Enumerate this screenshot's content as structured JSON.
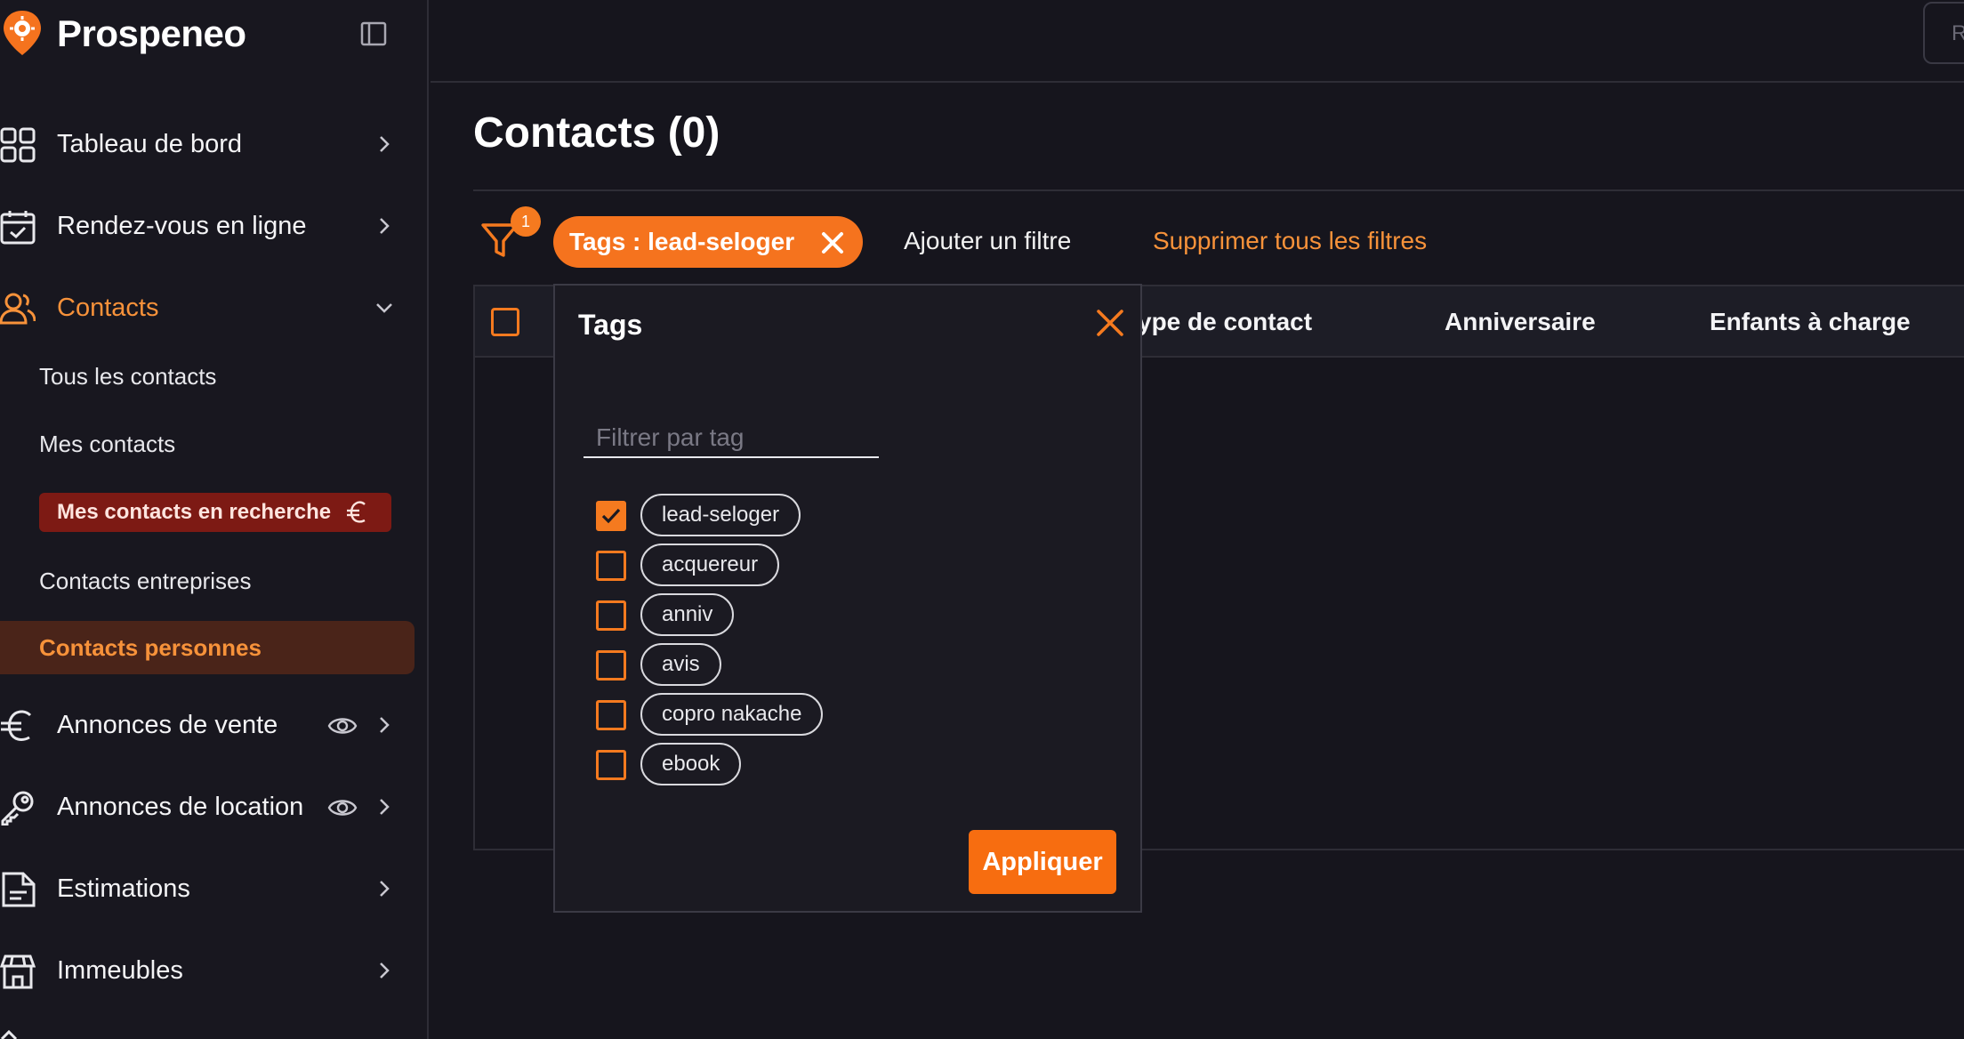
{
  "brand": {
    "name": "Prospeneo"
  },
  "sidebar": {
    "items": [
      {
        "label": "Tableau de bord"
      },
      {
        "label": "Rendez-vous en ligne"
      },
      {
        "label": "Contacts"
      },
      {
        "label": "Annonces de vente"
      },
      {
        "label": "Annonces de location"
      },
      {
        "label": "Estimations"
      },
      {
        "label": "Immeubles"
      }
    ],
    "sub_items": [
      {
        "label": "Tous les contacts"
      },
      {
        "label": "Mes contacts"
      },
      {
        "label": "Mes contacts en recherche"
      },
      {
        "label": "Contacts entreprises"
      },
      {
        "label": "Contacts personnes"
      }
    ]
  },
  "topbar": {
    "search_partial": "R"
  },
  "main": {
    "title": "Contacts (0)",
    "filter_count": "1",
    "active_filter": "Tags : lead-seloger",
    "add_filter_label": "Ajouter un filtre",
    "clear_filters_label": "Supprimer tous les filtres",
    "table_headers": [
      "ype de contact",
      "Anniversaire",
      "Enfants à charge"
    ]
  },
  "popup": {
    "title": "Tags",
    "search_placeholder": "Filtrer par tag",
    "tags": [
      {
        "label": "lead-seloger",
        "checked": true
      },
      {
        "label": "acquereur",
        "checked": false
      },
      {
        "label": "anniv",
        "checked": false
      },
      {
        "label": "avis",
        "checked": false
      },
      {
        "label": "copro nakache",
        "checked": false
      },
      {
        "label": "ebook",
        "checked": false
      }
    ],
    "apply_label": "Appliquer"
  },
  "colors": {
    "accent": "#f57a1f",
    "background": "#16151d",
    "highlight": "#7d1a14"
  }
}
